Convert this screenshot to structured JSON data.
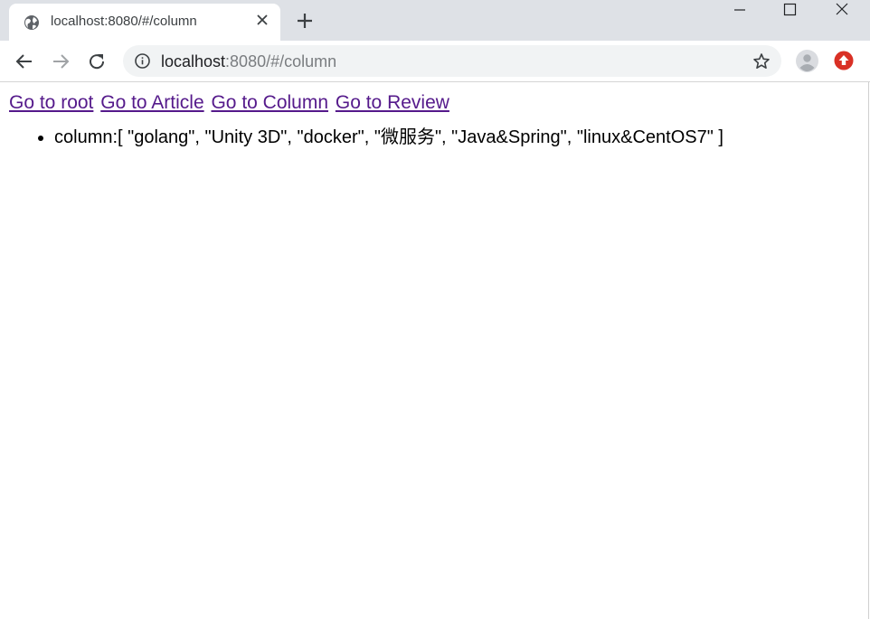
{
  "browser": {
    "tab": {
      "title": "localhost:8080/#/column"
    },
    "address_bar": {
      "host": "localhost",
      "rest": ":8080/#/column"
    },
    "icons": {
      "favicon": "globe-icon",
      "tab_close": "close-icon",
      "new_tab": "plus-icon",
      "back": "arrow-left-icon",
      "forward": "arrow-right-icon",
      "reload": "reload-icon",
      "info": "info-icon",
      "bookmark": "star-icon",
      "profile": "avatar-icon",
      "extension": "update-icon",
      "minimize": "minimize-icon",
      "maximize": "maximize-icon",
      "close_window": "close-window-icon"
    },
    "colors": {
      "tabstrip": "#dee1e6",
      "visited_link": "#551a8b",
      "extension_red": "#d93025"
    }
  },
  "page": {
    "nav_links": [
      {
        "label": "Go to root"
      },
      {
        "label": "Go to Article"
      },
      {
        "label": "Go to Column"
      },
      {
        "label": "Go to Review"
      }
    ],
    "list": [
      {
        "text": "column:[ \"golang\", \"Unity 3D\", \"docker\", \"微服务\", \"Java&Spring\", \"linux&CentOS7\" ]"
      }
    ]
  }
}
